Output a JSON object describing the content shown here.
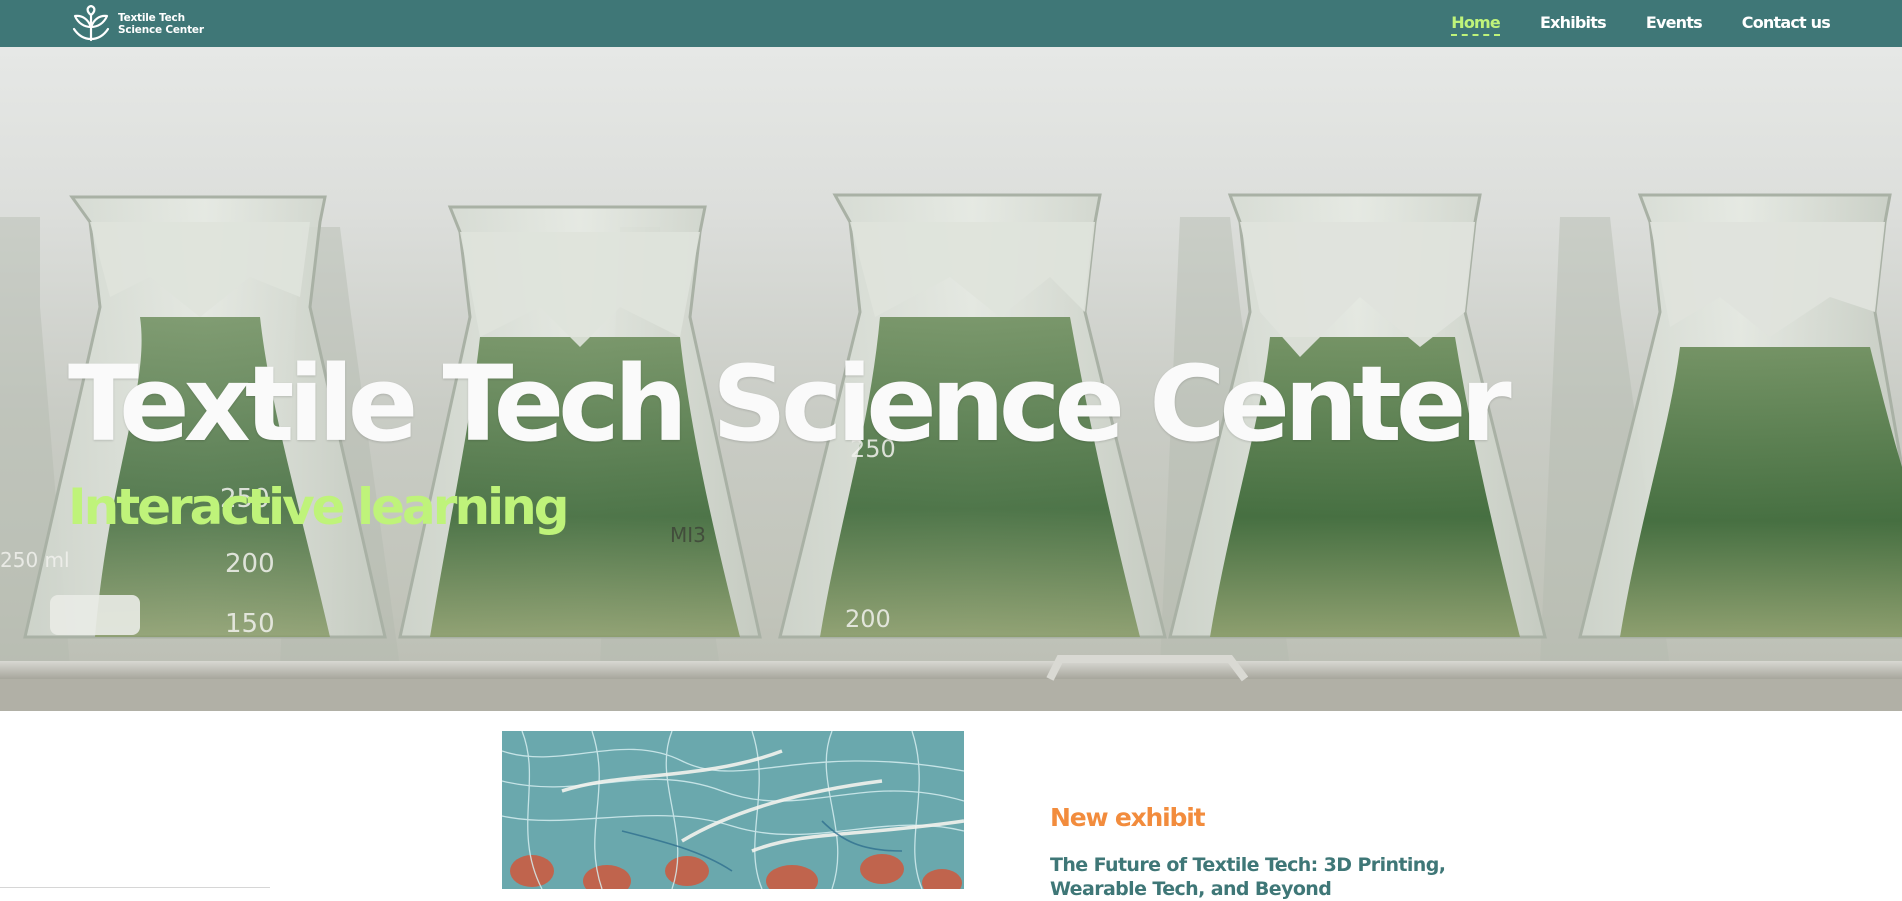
{
  "brand": {
    "name_line1": "Textile Tech",
    "name_line2": "Science Center",
    "logo_icon": "sprout-leaves-icon"
  },
  "nav": {
    "items": [
      {
        "label": "Home",
        "active": true
      },
      {
        "label": "Exhibits",
        "active": false
      },
      {
        "label": "Events",
        "active": false
      },
      {
        "label": "Contact us",
        "active": false
      }
    ]
  },
  "hero": {
    "title": "Textile Tech Science Center",
    "subtitle": "Interactive learning",
    "flask_markings": [
      "250 ml",
      "250",
      "200",
      "150",
      "MI3",
      "250",
      "200",
      "150"
    ]
  },
  "exhibit": {
    "label": "New exhibit",
    "title": "The Future of Textile Tech: 3D Printing, Wearable Tech, and Beyond"
  },
  "colors": {
    "header_bg": "#3f7777",
    "nav_active": "#bff37a",
    "subtitle": "#bff37a",
    "exhibit_label": "#f28c3d",
    "exhibit_title": "#3f7777"
  }
}
